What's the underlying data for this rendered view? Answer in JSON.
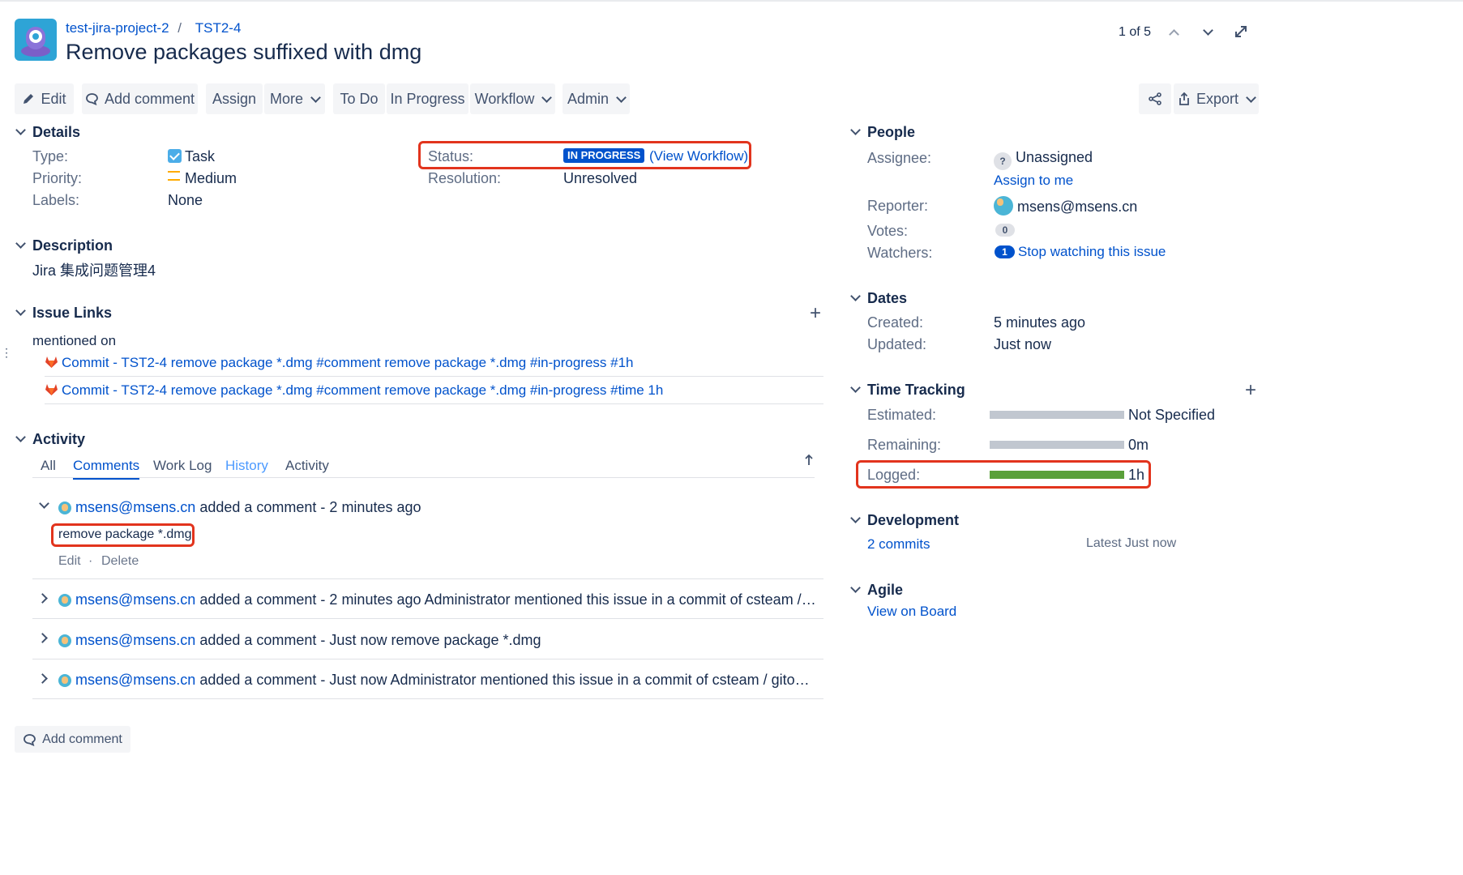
{
  "header": {
    "project": "test-jira-project-2",
    "separator": "/",
    "issue_key": "TST2-4",
    "title": "Remove packages suffixed with dmg",
    "pager": "1 of 5"
  },
  "toolbar": {
    "edit": "Edit",
    "add_comment": "Add comment",
    "assign": "Assign",
    "more": "More",
    "to_do": "To Do",
    "in_progress": "In Progress",
    "workflow": "Workflow",
    "admin": "Admin",
    "export": "Export"
  },
  "details": {
    "title": "Details",
    "type_label": "Type:",
    "type_value": "Task",
    "priority_label": "Priority:",
    "priority_value": "Medium",
    "labels_label": "Labels:",
    "labels_value": "None",
    "status_label": "Status:",
    "status_value": "IN PROGRESS",
    "view_workflow": "(View Workflow)",
    "resolution_label": "Resolution:",
    "resolution_value": "Unresolved"
  },
  "description": {
    "title": "Description",
    "text": "Jira 集成问题管理4"
  },
  "issue_links": {
    "title": "Issue Links",
    "group": "mentioned on",
    "items": [
      "Commit - TST2-4 remove package *.dmg #comment remove package *.dmg #in-progress #1h",
      "Commit - TST2-4 remove package *.dmg #comment remove package *.dmg #in-progress #time 1h"
    ]
  },
  "activity": {
    "title": "Activity",
    "tabs": [
      "All",
      "Comments",
      "Work Log",
      "History",
      "Activity"
    ],
    "active_tab": "Comments",
    "comments": [
      {
        "author": "msens@msens.cn",
        "meta": "added a comment - 2 minutes ago",
        "body": "remove package *.dmg"
      },
      {
        "author": "msens@msens.cn",
        "meta": "added a comment - 2 minutes ago Administrator mentioned this issue in a commit of csteam / gitops on branc..."
      },
      {
        "author": "msens@msens.cn",
        "meta": "added a comment - Just now remove package *.dmg"
      },
      {
        "author": "msens@msens.cn",
        "meta": "added a comment - Just now Administrator mentioned this issue in a commit of csteam / gitops on branch mai..."
      }
    ],
    "edit": "Edit",
    "dot": "·",
    "delete": "Delete",
    "add_comment": "Add comment"
  },
  "people": {
    "title": "People",
    "assignee_label": "Assignee:",
    "assignee_value": "Unassigned",
    "assign_to_me": "Assign to me",
    "reporter_label": "Reporter:",
    "reporter_value": "msens@msens.cn",
    "votes_label": "Votes:",
    "votes_value": "0",
    "watchers_label": "Watchers:",
    "watchers_count": "1",
    "watchers_action": "Stop watching this issue"
  },
  "dates": {
    "title": "Dates",
    "created_label": "Created:",
    "created_value": "5 minutes ago",
    "updated_label": "Updated:",
    "updated_value": "Just now"
  },
  "time_tracking": {
    "title": "Time Tracking",
    "estimated_label": "Estimated:",
    "estimated_value": "Not Specified",
    "remaining_label": "Remaining:",
    "remaining_value": "0m",
    "logged_label": "Logged:",
    "logged_value": "1h",
    "logged_fraction": 1.0
  },
  "development": {
    "title": "Development",
    "commits": "2 commits",
    "latest": "Latest Just now"
  },
  "agile": {
    "title": "Agile",
    "view_on_board": "View on Board"
  },
  "colors": {
    "link": "#0052cc",
    "status_badge": "#0052cc",
    "highlight": "#e2341d",
    "logged_bar": "#5aa03a"
  }
}
